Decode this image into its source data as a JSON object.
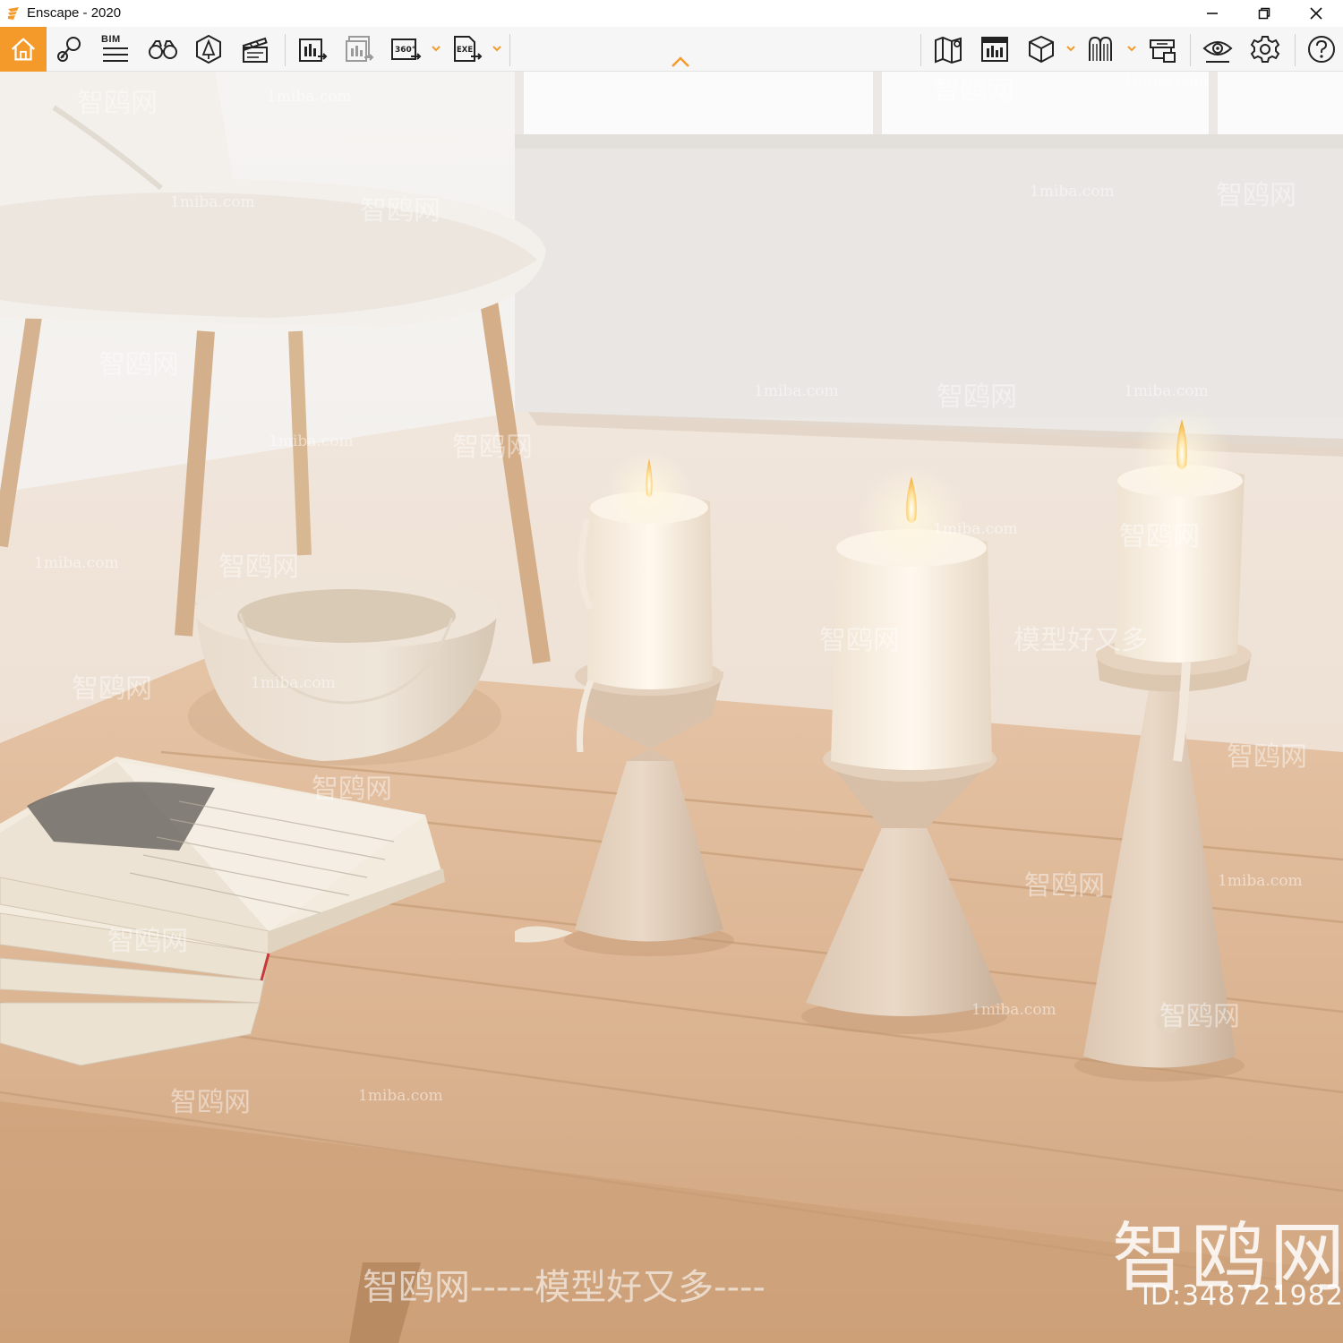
{
  "window": {
    "title": "Enscape - 2020",
    "controls": {
      "minimize": "minimize-icon",
      "restore": "restore-icon",
      "close": "close-icon"
    }
  },
  "toolbar": {
    "accent_color": "#f39a2b",
    "bim_label": "BIM",
    "groups": [
      {
        "items": [
          "home-icon",
          "location-pin-icon",
          "bim-info-icon",
          "binoculars-icon",
          "asset-library-icon",
          "video-editor-icon"
        ]
      },
      {
        "items": [
          "render-screenshot-icon",
          "batch-render-icon",
          "panorama-360-icon",
          "exe-export-icon"
        ]
      },
      {
        "items": [
          "map-view-icon",
          "view-management-icon",
          "cube-view-icon",
          "material-editor-icon",
          "capture-icon",
          "visual-settings-icon",
          "settings-icon",
          "help-icon"
        ]
      }
    ],
    "collapse_icon": "chevron-up-icon"
  },
  "viewport": {
    "watermarks": {
      "site": "1miba.com",
      "brand_cn": "智鸥网",
      "slogan_cn": "模型好又多",
      "dash": "————",
      "bottom_banner": "智鸥网-----模型好又多----",
      "big_brand": "智鸥网",
      "id_label": "ID:348721982"
    }
  }
}
